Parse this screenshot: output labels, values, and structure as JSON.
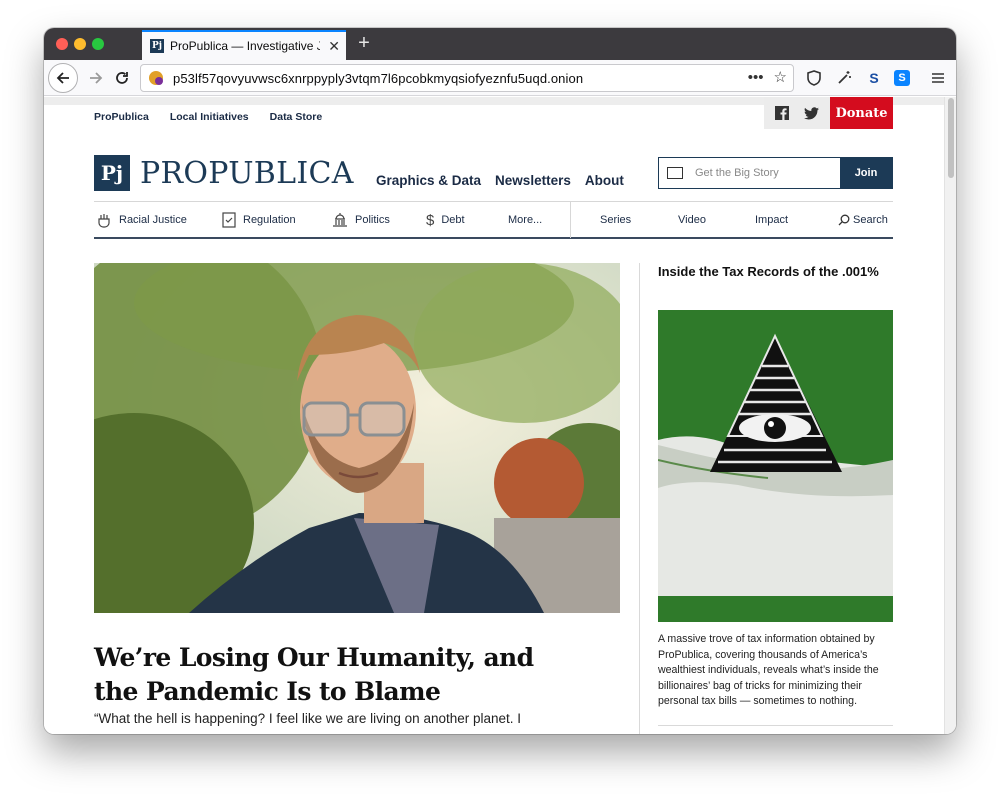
{
  "browser": {
    "tab_title": "ProPublica — Investigative Jour",
    "tab_favicon": "Pj",
    "new_tab": "+",
    "url": "p53lf57qovyuvwsc6xnrppyply3vtqm7l6pcobkmyqsiofyeznfu5uqd.onion",
    "page_actions": "•••",
    "ext_s_label": "S"
  },
  "topbar": {
    "links": [
      "ProPublica",
      "Local Initiatives",
      "Data Store"
    ],
    "donate": "Donate"
  },
  "header": {
    "logo_mark": "Pj",
    "logo_text": "PROPUBLICA",
    "nav": [
      "Graphics & Data",
      "Newsletters",
      "About"
    ],
    "subscribe_placeholder": "Get the Big Story",
    "join": "Join"
  },
  "secnav": {
    "left": [
      {
        "label": "Racial Justice",
        "icon": "fist-icon"
      },
      {
        "label": "Regulation",
        "icon": "checklist-icon"
      },
      {
        "label": "Politics",
        "icon": "capitol-icon"
      },
      {
        "label": "Debt",
        "icon": "dollar-icon"
      },
      {
        "label": "More...",
        "icon": ""
      }
    ],
    "right": [
      "Series",
      "Video",
      "Impact",
      "Search"
    ]
  },
  "main": {
    "headline": "We’re Losing Our Humanity, and the Pandemic Is to Blame",
    "dek": "“What the hell is happening? I feel like we are living on another planet. I"
  },
  "sidebar": {
    "title": "Inside the Tax Records of the .001%",
    "summary": "A massive trove of tax information obtained by ProPublica, covering thousands of America’s wealthiest individuals, reveals what’s inside the billionaires’ bag of tricks for minimizing their personal tax bills — sometimes to nothing."
  },
  "colors": {
    "brand_navy": "#1c3a56",
    "donate_red": "#d40c1e",
    "illustration_green": "#2f7a2a",
    "tab_accent": "#0a84ff"
  }
}
